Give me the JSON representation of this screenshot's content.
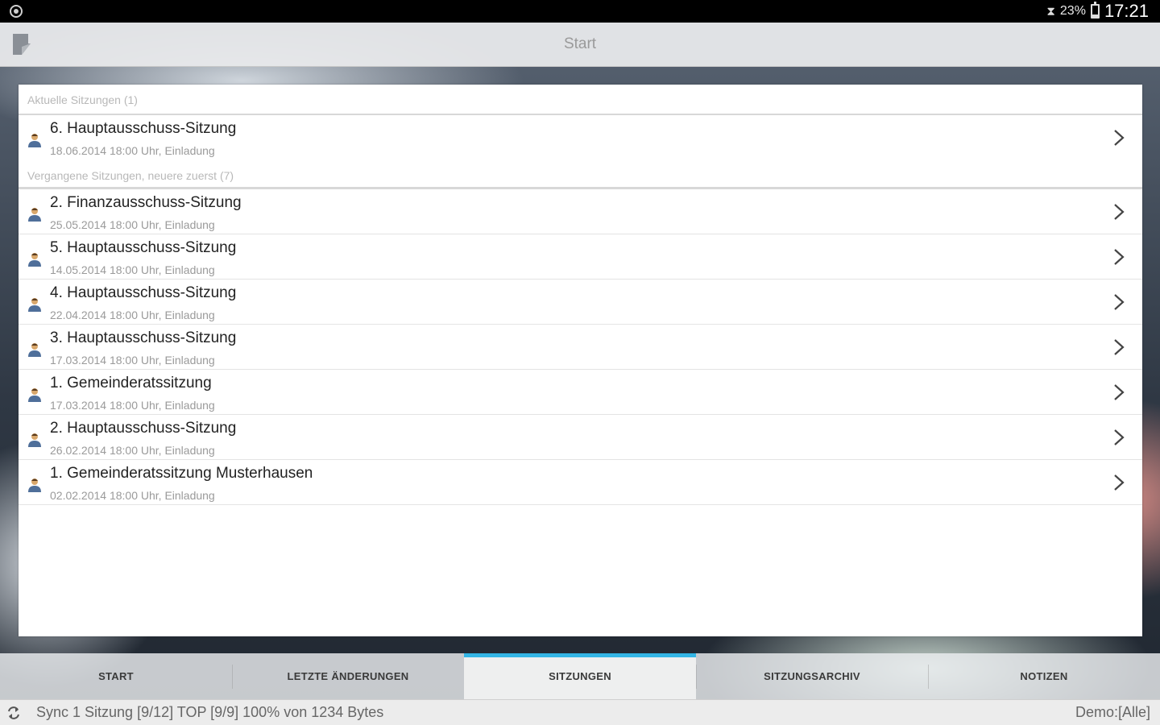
{
  "status_bar": {
    "battery_percent": "23%",
    "time": "17:21"
  },
  "action_bar": {
    "title": "Start"
  },
  "sections": {
    "current": {
      "label": "Aktuelle Sitzungen (1)",
      "items": [
        {
          "title": "6. Hauptausschuss-Sitzung",
          "subtitle": "18.06.2014 18:00 Uhr, Einladung"
        }
      ]
    },
    "past": {
      "label": "Vergangene Sitzungen, neuere zuerst (7)",
      "items": [
        {
          "title": "2. Finanzausschuss-Sitzung",
          "subtitle": "25.05.2014 18:00 Uhr, Einladung"
        },
        {
          "title": "5. Hauptausschuss-Sitzung",
          "subtitle": "14.05.2014 18:00 Uhr, Einladung"
        },
        {
          "title": "4. Hauptausschuss-Sitzung",
          "subtitle": "22.04.2014 18:00 Uhr, Einladung"
        },
        {
          "title": "3. Hauptausschuss-Sitzung",
          "subtitle": "17.03.2014 18:00 Uhr, Einladung"
        },
        {
          "title": "1. Gemeinderatssitzung",
          "subtitle": "17.03.2014 18:00 Uhr, Einladung"
        },
        {
          "title": "2. Hauptausschuss-Sitzung",
          "subtitle": "26.02.2014 18:00 Uhr, Einladung"
        },
        {
          "title": "1. Gemeinderatssitzung Musterhausen",
          "subtitle": "02.02.2014 18:00 Uhr, Einladung"
        }
      ]
    }
  },
  "tabs": [
    {
      "label": "START"
    },
    {
      "label": "LETZTE ÄNDERUNGEN"
    },
    {
      "label": "SITZUNGEN",
      "active": true
    },
    {
      "label": "SITZUNGSARCHIV"
    },
    {
      "label": "NOTIZEN"
    }
  ],
  "sync_bar": {
    "text": "Sync 1 Sitzung [9/12] TOP [9/9] 100% von 1234 Bytes",
    "user": "Demo:[Alle]"
  },
  "colors": {
    "accent": "#33b5e5",
    "status_bar": "#000000",
    "card": "#ffffff"
  }
}
